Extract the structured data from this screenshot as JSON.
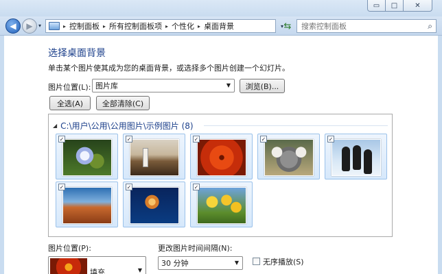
{
  "window": {
    "minimize_glyph": "▭",
    "maximize_glyph": "□",
    "close_glyph": "✕"
  },
  "nav": {
    "back_glyph": "◀",
    "forward_glyph": "▶",
    "dropdown_glyph": "▾"
  },
  "address": {
    "icon": "control-panel-icon",
    "separator": "▸",
    "crumbs": [
      "控制面板",
      "所有控制面板项",
      "个性化",
      "桌面背景"
    ]
  },
  "search": {
    "placeholder": "搜索控制面板",
    "icon_glyph": "⌕"
  },
  "page": {
    "title": "选择桌面背景",
    "description": "单击某个图片使其成为您的桌面背景，或选择多个图片创建一个幻灯片。",
    "location_label": "图片位置(L):",
    "location_value": "图片库",
    "browse_label": "浏览(B)...",
    "select_all_label": "全选(A)",
    "clear_all_label": "全部清除(C)"
  },
  "gallery": {
    "group_toggle": "◢",
    "group_title": "C:\\用户\\公用\\公用图片\\示例图片 (8)",
    "items": [
      {
        "name": "hydrangeas",
        "checked": "✓"
      },
      {
        "name": "lighthouse",
        "checked": "✓"
      },
      {
        "name": "chrysanthemum",
        "checked": "✓"
      },
      {
        "name": "koala",
        "checked": "✓"
      },
      {
        "name": "penguins",
        "checked": "✓"
      },
      {
        "name": "desert",
        "checked": "✓"
      },
      {
        "name": "jellyfish",
        "checked": "✓"
      },
      {
        "name": "tulips",
        "checked": "✓"
      }
    ]
  },
  "bottom": {
    "position_label": "图片位置(P):",
    "position_value": "填充",
    "interval_label": "更改图片时间间隔(N):",
    "interval_value": "30 分钟",
    "shuffle_label": "无序播放(S)"
  }
}
